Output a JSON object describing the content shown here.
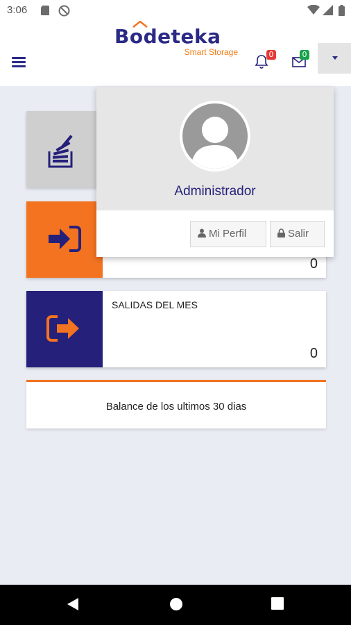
{
  "status_bar": {
    "time": "3:06",
    "icons": [
      "sd-card-icon",
      "do-not-disturb-icon",
      "wifi-icon",
      "signal-icon",
      "battery-icon"
    ]
  },
  "header": {
    "logo_title": "Bodeteka",
    "logo_subtitle": "Smart Storage",
    "notifications_count": "0",
    "messages_count": "0"
  },
  "cards": [
    {
      "title": "",
      "value": "",
      "icon": "stack-icon"
    },
    {
      "title": "",
      "value": "0",
      "icon": "sign-in-icon"
    },
    {
      "title": "SALIDAS DEL MES",
      "value": "0",
      "icon": "sign-out-icon"
    }
  ],
  "balance": {
    "title": "Balance de los ultimos 30 dias"
  },
  "profile_menu": {
    "name": "Administrador",
    "profile_label": "Mi Perfil",
    "logout_label": "Salir"
  },
  "colors": {
    "brand_navy": "#25207a",
    "brand_orange": "#f37321",
    "badge_red": "#e53935",
    "badge_green": "#17a34a"
  }
}
